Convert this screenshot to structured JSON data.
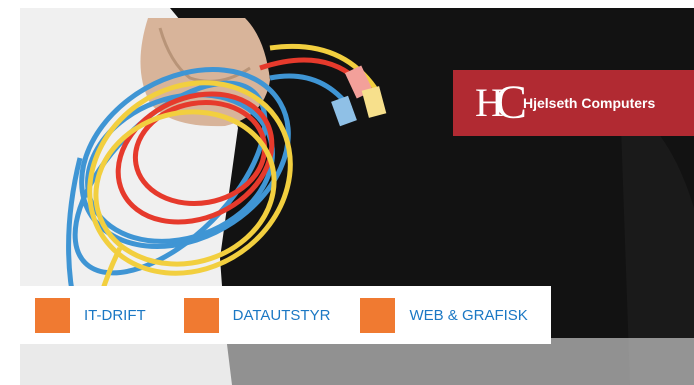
{
  "brand": {
    "logo_h": "H",
    "logo_c": "C",
    "name": "Hjelseth Computers",
    "color": "#b12a32"
  },
  "hero": {
    "icon": "hand-holding-network-cables-photo",
    "cable_colors": [
      "#3f95d4",
      "#e63a2c",
      "#f2cf3f"
    ]
  },
  "menu": {
    "accent": "#f07a31",
    "label_color": "#1b78c4",
    "items": [
      {
        "label": "IT-DRIFT"
      },
      {
        "label": "DATAUTSTYR"
      },
      {
        "label": "WEB & GRAFISK"
      }
    ]
  }
}
